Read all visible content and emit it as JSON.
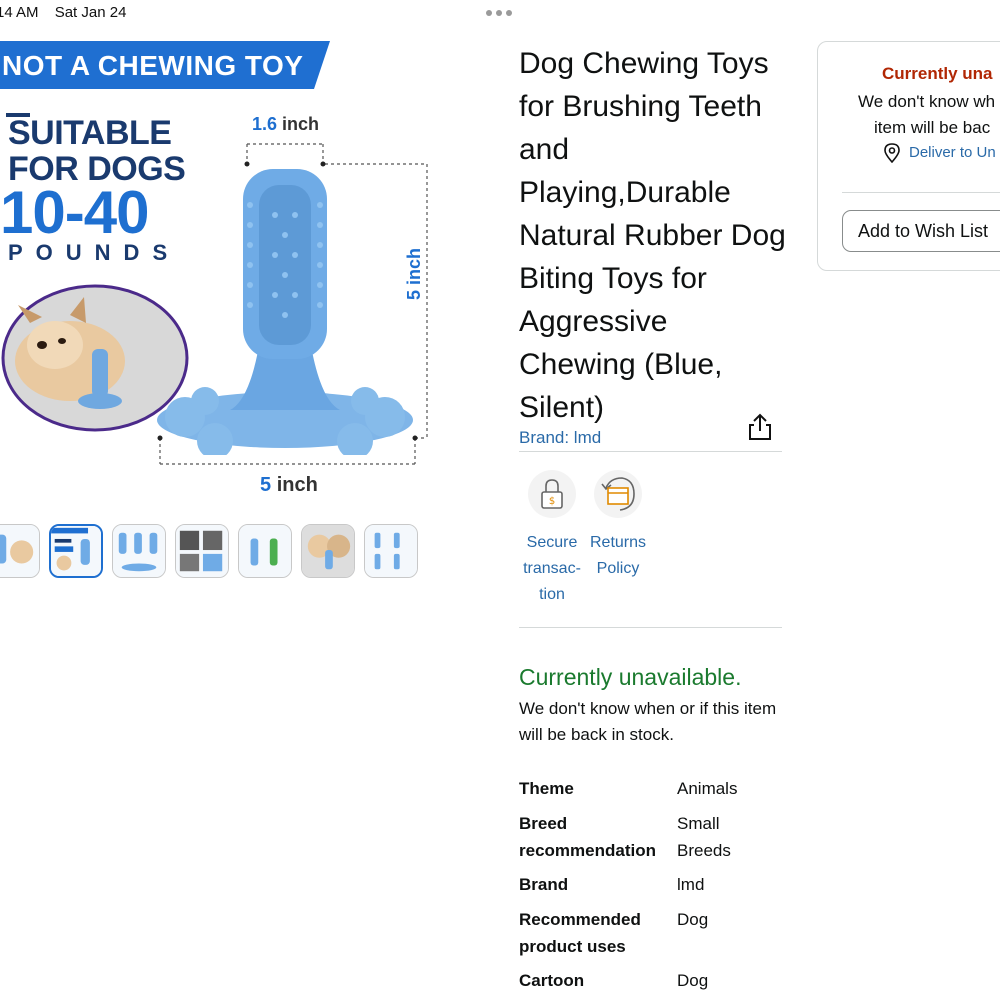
{
  "status_bar": {
    "time": "14 AM",
    "date": "Sat Jan 24"
  },
  "product_image": {
    "banner": "NOT A CHEWING TOY",
    "suitable_line1": "SUITABLE",
    "suitable_line2": "FOR DOGS",
    "weight_range": "10-40",
    "weight_unit": "POUNDS",
    "width_top_value": "1.6",
    "width_top_unit": "inch",
    "height_value": "5",
    "height_unit": "inch",
    "width_bottom_value": "5",
    "width_bottom_unit": "inch",
    "accent_color": "#1e6fd0",
    "toy_color": "#7fb5e8"
  },
  "thumbnails": [
    "thumb-1",
    "thumb-2",
    "thumb-3",
    "thumb-4",
    "thumb-5",
    "thumb-6",
    "thumb-7"
  ],
  "selected_thumbnail_index": 1,
  "title": "Dog Chewing Toys for Brushing Teeth and Playing,Durable Natural Rubber Dog Biting Toys for Aggressive Chewing (Blue, Silent)",
  "brand_link": "Brand: lmd",
  "badges": [
    {
      "icon": "lock-icon",
      "line1": "Secure",
      "line2": "transac-",
      "line3": "tion"
    },
    {
      "icon": "returns-icon",
      "line1": "Returns",
      "line2": "Policy"
    }
  ],
  "availability": {
    "status": "Currently unavailable.",
    "note": "We don't know when or if this item will be back in stock."
  },
  "specs": [
    {
      "key1": "Theme",
      "key2": "",
      "val1": "Animals",
      "val2": ""
    },
    {
      "key1": "Breed",
      "key2": "recommendation",
      "val1": "Small",
      "val2": "Breeds"
    },
    {
      "key1": "Brand",
      "key2": "",
      "val1": "lmd",
      "val2": ""
    },
    {
      "key1": "Recommended",
      "key2": "product uses",
      "val1": "Dog",
      "val2": ""
    },
    {
      "key1": "Cartoon",
      "key2": "",
      "val1": "Dog",
      "val2": ""
    }
  ],
  "buy_box": {
    "title": "Currently una",
    "note_line1": "We don't know wh",
    "note_line2": "item will be bac",
    "deliver": "Deliver to Un",
    "wish_list": "Add to Wish List"
  },
  "colors": {
    "link": "#2a6aa8",
    "available_green": "#1a7a2e",
    "alert_red": "#b12704"
  }
}
